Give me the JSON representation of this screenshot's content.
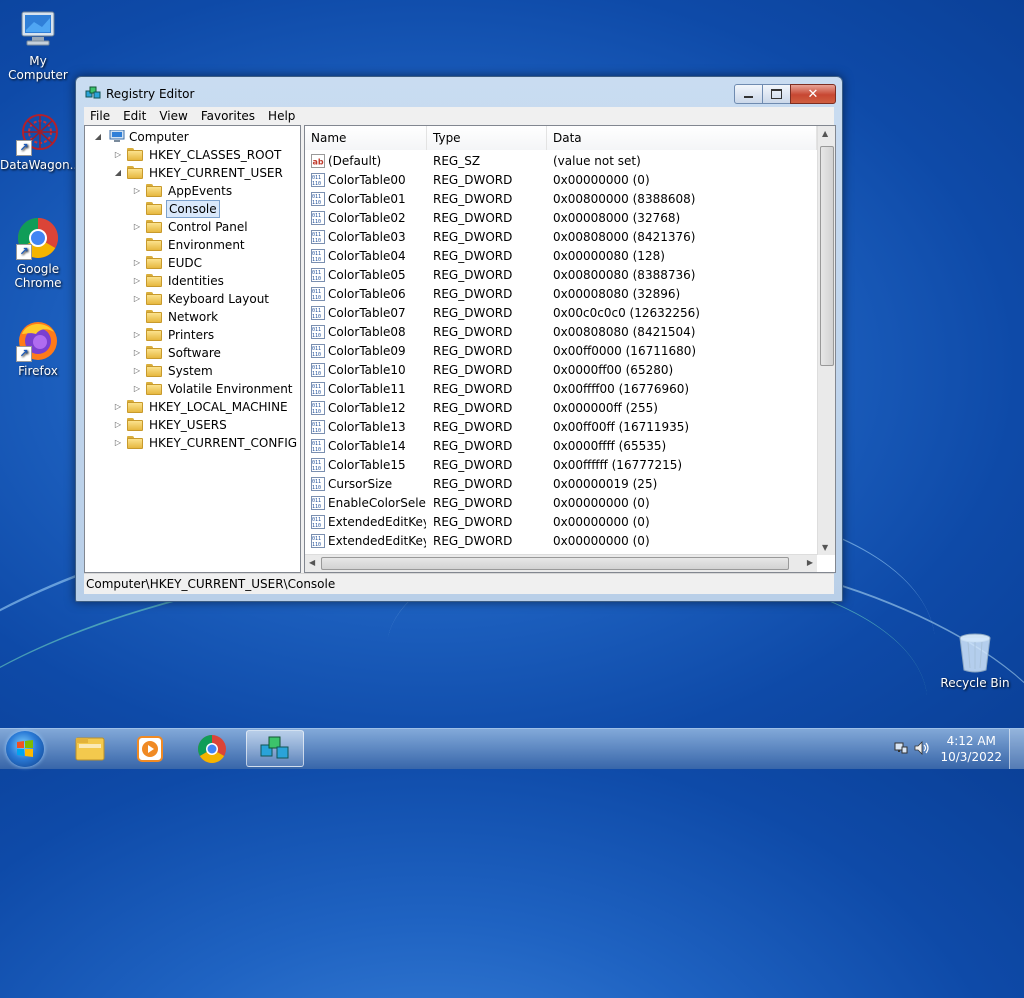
{
  "desktop": {
    "icons": [
      {
        "label": "My Computer"
      },
      {
        "label": "DataWagon..."
      },
      {
        "label": "Google Chrome"
      },
      {
        "label": "Firefox"
      },
      {
        "label": "Recycle Bin"
      }
    ]
  },
  "window": {
    "title": "Registry Editor",
    "controls": {
      "minimize": "minimize-icon",
      "maximize": "maximize-icon",
      "close": "✕"
    }
  },
  "menu": [
    "File",
    "Edit",
    "View",
    "Favorites",
    "Help"
  ],
  "tree": {
    "root": "Computer",
    "items": [
      {
        "label": "HKEY_CLASSES_ROOT"
      },
      {
        "label": "HKEY_CURRENT_USER"
      },
      {
        "label": "AppEvents"
      },
      {
        "label": "Console"
      },
      {
        "label": "Control Panel"
      },
      {
        "label": "Environment"
      },
      {
        "label": "EUDC"
      },
      {
        "label": "Identities"
      },
      {
        "label": "Keyboard Layout"
      },
      {
        "label": "Network"
      },
      {
        "label": "Printers"
      },
      {
        "label": "Software"
      },
      {
        "label": "System"
      },
      {
        "label": "Volatile Environment"
      },
      {
        "label": "HKEY_LOCAL_MACHINE"
      },
      {
        "label": "HKEY_USERS"
      },
      {
        "label": "HKEY_CURRENT_CONFIG"
      }
    ],
    "selected": "Console"
  },
  "list": {
    "columns": [
      "Name",
      "Type",
      "Data"
    ],
    "rows": [
      {
        "name": "(Default)",
        "type": "REG_SZ",
        "data": "(value not set)",
        "icon": "string-value-icon"
      },
      {
        "name": "ColorTable00",
        "type": "REG_DWORD",
        "data": "0x00000000 (0)",
        "icon": "binary-value-icon"
      },
      {
        "name": "ColorTable01",
        "type": "REG_DWORD",
        "data": "0x00800000 (8388608)",
        "icon": "binary-value-icon"
      },
      {
        "name": "ColorTable02",
        "type": "REG_DWORD",
        "data": "0x00008000 (32768)",
        "icon": "binary-value-icon"
      },
      {
        "name": "ColorTable03",
        "type": "REG_DWORD",
        "data": "0x00808000 (8421376)",
        "icon": "binary-value-icon"
      },
      {
        "name": "ColorTable04",
        "type": "REG_DWORD",
        "data": "0x00000080 (128)",
        "icon": "binary-value-icon"
      },
      {
        "name": "ColorTable05",
        "type": "REG_DWORD",
        "data": "0x00800080 (8388736)",
        "icon": "binary-value-icon"
      },
      {
        "name": "ColorTable06",
        "type": "REG_DWORD",
        "data": "0x00008080 (32896)",
        "icon": "binary-value-icon"
      },
      {
        "name": "ColorTable07",
        "type": "REG_DWORD",
        "data": "0x00c0c0c0 (12632256)",
        "icon": "binary-value-icon"
      },
      {
        "name": "ColorTable08",
        "type": "REG_DWORD",
        "data": "0x00808080 (8421504)",
        "icon": "binary-value-icon"
      },
      {
        "name": "ColorTable09",
        "type": "REG_DWORD",
        "data": "0x00ff0000 (16711680)",
        "icon": "binary-value-icon"
      },
      {
        "name": "ColorTable10",
        "type": "REG_DWORD",
        "data": "0x0000ff00 (65280)",
        "icon": "binary-value-icon"
      },
      {
        "name": "ColorTable11",
        "type": "REG_DWORD",
        "data": "0x00ffff00 (16776960)",
        "icon": "binary-value-icon"
      },
      {
        "name": "ColorTable12",
        "type": "REG_DWORD",
        "data": "0x000000ff (255)",
        "icon": "binary-value-icon"
      },
      {
        "name": "ColorTable13",
        "type": "REG_DWORD",
        "data": "0x00ff00ff (16711935)",
        "icon": "binary-value-icon"
      },
      {
        "name": "ColorTable14",
        "type": "REG_DWORD",
        "data": "0x0000ffff (65535)",
        "icon": "binary-value-icon"
      },
      {
        "name": "ColorTable15",
        "type": "REG_DWORD",
        "data": "0x00ffffff (16777215)",
        "icon": "binary-value-icon"
      },
      {
        "name": "CursorSize",
        "type": "REG_DWORD",
        "data": "0x00000019 (25)",
        "icon": "binary-value-icon"
      },
      {
        "name": "EnableColorSele...",
        "type": "REG_DWORD",
        "data": "0x00000000 (0)",
        "icon": "binary-value-icon"
      },
      {
        "name": "ExtendedEditKey",
        "type": "REG_DWORD",
        "data": "0x00000000 (0)",
        "icon": "binary-value-icon"
      },
      {
        "name": "ExtendedEditKey...",
        "type": "REG_DWORD",
        "data": "0x00000000 (0)",
        "icon": "binary-value-icon"
      }
    ]
  },
  "status": "Computer\\HKEY_CURRENT_USER\\Console",
  "taskbar": {
    "apps": [
      "file-explorer-icon",
      "media-player-icon",
      "chrome-icon",
      "registry-editor-icon"
    ],
    "time": "4:12 AM",
    "date": "10/3/2022"
  },
  "colors": {
    "selection": "#d9e8fb",
    "close_button": "#c74732",
    "desktop": "#1f63c2"
  }
}
